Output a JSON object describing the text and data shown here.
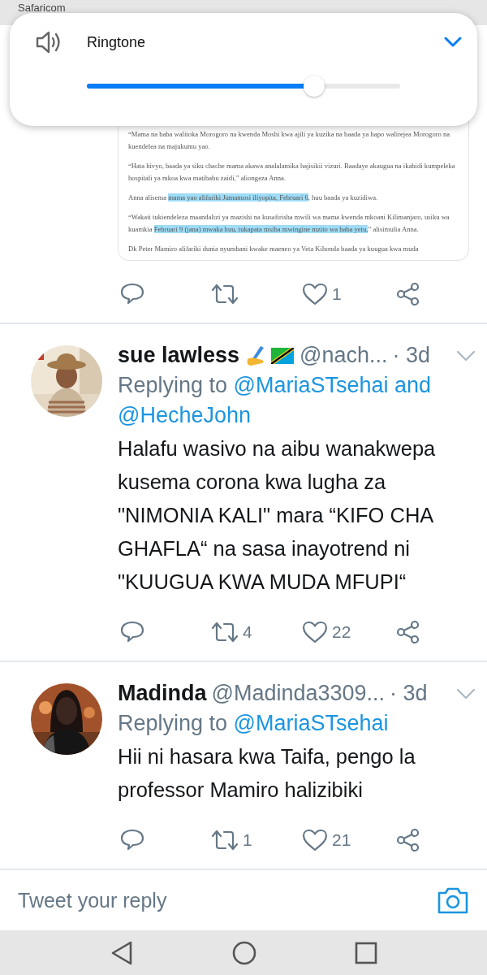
{
  "status_bar": {
    "carrier": "Safaricom"
  },
  "volume_panel": {
    "label": "Ringtone",
    "level": 0.725
  },
  "tweets": [
    {
      "kind": "partial",
      "document": {
        "paragraphs": [
          [
            {
              "text": "“Mama na baba walitoka Morogoro na kwenda Moshi kwa ajili ya kuzika na baada ya hapo walirejea Morogoro na kuendelea na majukumu yao.",
              "highlighted": false
            }
          ],
          [
            {
              "text": "“Hata hivyo, baada ya siku chache mama akawa analalamika hajisikii vizuri. Baadaye akaugua na ikabidi kumpeleka hospitali ya mkoa kwa matibabu zaidi,” aliongeza Anna.",
              "highlighted": false
            }
          ],
          [
            {
              "text": "Anna alisema ",
              "highlighted": false
            },
            {
              "text": "mama yao alifariki Jumamosi iliyopita, Februari 6",
              "highlighted": true
            },
            {
              "text": ", huu baada ya kuzidiwa.",
              "highlighted": false
            }
          ],
          [
            {
              "text": "“Wakati tukiendeleza maandalizi ya mazishi na kusafirisha mwili wa mama kwenda mkoani Kilimanjaro, usiku wa kuamkia ",
              "highlighted": false
            },
            {
              "text": "Februari 9 (jana) mwaka huu, tukapata msiba mwingine mzito wa baba yetu,",
              "highlighted": true
            },
            {
              "text": "” alisimulia Anna.",
              "highlighted": false
            }
          ],
          [
            {
              "text": "Dk Peter Mamiro alifariki dunia nyumbani kwake maeneo ya Veta Kihonda baada ya kuugua kwa muda",
              "highlighted": false
            }
          ]
        ]
      },
      "actions": {
        "likes": "1"
      }
    },
    {
      "kind": "full",
      "avatar": {
        "kind": "picture"
      },
      "author": "sue lawless",
      "badges": [
        {
          "kind": "writing-hand"
        },
        {
          "kind": "flag"
        }
      ],
      "handle": "@nach...",
      "time": "· 3d",
      "reply_label": "Replying to",
      "reply_targets": [
        "@MariaSTsehai and",
        "@HecheJohn"
      ],
      "text": "Halafu wasivo na aibu wanakwepa kusema corona  kwa lugha za \"NIMONIA KALI\" mara “KIFO CHA GHAFLA“ na sasa inayotrend ni \"KUUGUA KWA MUDA MFUPI“",
      "actions": {
        "retweets": "4",
        "likes": "22"
      }
    },
    {
      "kind": "full",
      "avatar": {
        "kind": "picture"
      },
      "author": "Madinda",
      "handle": "@Madinda3309...",
      "time": "· 3d",
      "reply_label": "Replying to",
      "reply_targets": [
        "@MariaSTsehai"
      ],
      "text": "Hii ni hasara kwa Taifa, pengo la professor Mamiro halizibiki",
      "actions": {
        "retweets": "1",
        "likes": "21"
      }
    }
  ],
  "reply_bar": {
    "placeholder": "Tweet your reply"
  }
}
